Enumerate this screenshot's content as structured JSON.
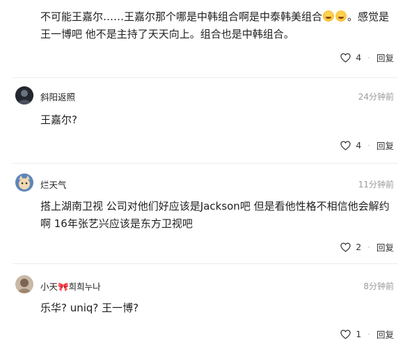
{
  "comments": [
    {
      "text_a": "不可能王嘉尔……王嘉尔那个哪是中韩组合啊是中泰韩美组合",
      "emojis": [
        "laugh-cry-emoji",
        "laugh-cry-emoji"
      ],
      "text_b": "。感觉是王一博吧 他不是主持了天天向上。组合也是中韩组合。",
      "likes": "4",
      "reply_label": "回复"
    },
    {
      "username": "斜阳返照",
      "time": "24分钟前",
      "text": "王嘉尔?",
      "likes": "4",
      "reply_label": "回复"
    },
    {
      "username": "烂天气",
      "time": "11分钟前",
      "text": "搭上湖南卫视 公司对他们好应该是Jackson吧 但是看他性格不相信他会解约啊 16年张艺兴应该是东方卫视吧",
      "likes": "2",
      "reply_label": "回复"
    },
    {
      "username": "小天🎀희희누나",
      "time": "8分钟前",
      "text": "乐华? uniq? 王一博?",
      "likes": "1",
      "reply_label": "回复"
    }
  ],
  "colors": {
    "text": "#1e1e1e",
    "meta": "#9a9a9a",
    "divider": "#ececec"
  }
}
